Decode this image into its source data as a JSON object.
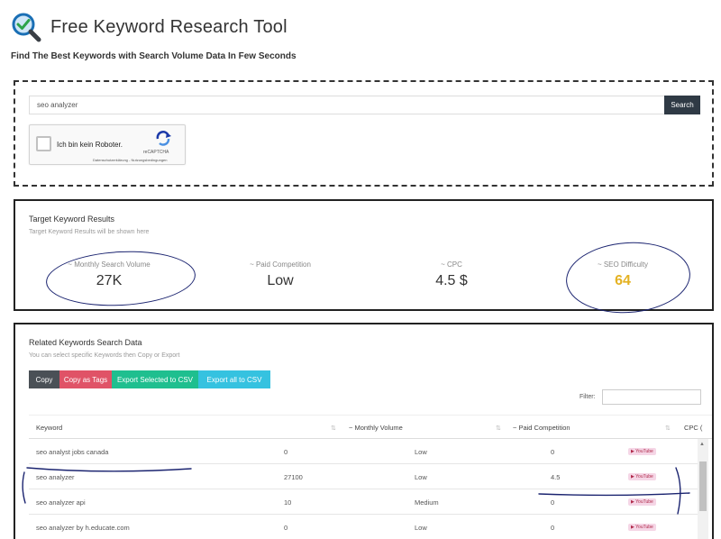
{
  "header": {
    "title": "Free Keyword Research Tool",
    "subtitle": "Find The Best Keywords with Search Volume Data In Few Seconds",
    "logo_icon": "magnifier-check-icon"
  },
  "search": {
    "value": "seo analyzer",
    "button_label": "Search"
  },
  "captcha": {
    "label": "Ich bin kein Roboter.",
    "brand": "reCAPTCHA",
    "links": "Datenschutzerklärung - Nutzungsbedingungen"
  },
  "target": {
    "title": "Target Keyword Results",
    "subtitle": "Target Keyword Results will be shown here",
    "metrics": [
      {
        "label": "~ Monthly Search Volume",
        "value": "27K"
      },
      {
        "label": "~ Paid Competition",
        "value": "Low"
      },
      {
        "label": "~ CPC",
        "value": "4.5 $"
      },
      {
        "label": "~ SEO Difficulty",
        "value": "64"
      }
    ],
    "accent_color": "#e4b223"
  },
  "related": {
    "title": "Related Keywords Search Data",
    "subtitle": "You can select specific Keywords then Copy or Export",
    "buttons": [
      {
        "label": "Copy",
        "color": "#4a5056"
      },
      {
        "label": "Copy as Tags",
        "color": "#e05367"
      },
      {
        "label": "Export Selected to CSV",
        "color": "#1fbf8f"
      },
      {
        "label": "Export all to CSV",
        "color": "#35c2e0"
      }
    ],
    "filter_label": "Filter:",
    "columns": [
      "Keyword",
      "~ Monthly Volume",
      "~ Paid Competition",
      "CPC ("
    ],
    "rows": [
      {
        "keyword": "seo analyst jobs canada",
        "volume": "0",
        "competition": "Low",
        "cpc": "0",
        "badge": "YouTube"
      },
      {
        "keyword": "seo analyzer",
        "volume": "27100",
        "competition": "Low",
        "cpc": "4.5",
        "badge": "YouTube"
      },
      {
        "keyword": "seo analyzer api",
        "volume": "10",
        "competition": "Medium",
        "cpc": "0",
        "badge": "YouTube"
      },
      {
        "keyword": "seo analyzer by h.educate.com",
        "volume": "0",
        "competition": "Low",
        "cpc": "0",
        "badge": "YouTube"
      }
    ]
  },
  "annotation_color": "#1b2470"
}
